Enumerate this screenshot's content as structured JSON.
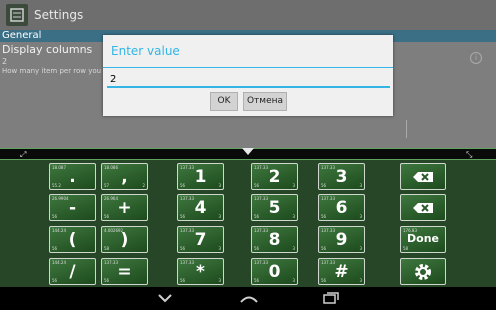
{
  "app": {
    "title": "Settings",
    "icon": "settings-app-icon"
  },
  "prefs": {
    "section": "General",
    "title": "Display columns",
    "value": "2",
    "summary": "How many item per row you w",
    "info_icon": "info-icon"
  },
  "dialog": {
    "title": "Enter value",
    "input_value": "2",
    "ok_label": "OK",
    "cancel_label": "Отмена"
  },
  "keyboard": {
    "colors": {
      "key_bg": "#2f632f",
      "board_bg": "#274527",
      "accent": "#33b5e5"
    },
    "strip": {
      "left_icon": "expand-icon",
      "center_icon": "collapse-arrow-icon",
      "right_icon": "resize-icon"
    },
    "keys": [
      {
        "id": "dot",
        "label": ".",
        "tl": "18.087",
        "tr": "",
        "bl": "55.2",
        "br": "",
        "row": 0,
        "col": 0
      },
      {
        "id": "comma",
        "label": ",",
        "tl": "18.086",
        "tr": "1",
        "bl": "57",
        "br": "2",
        "row": 0,
        "col": 1
      },
      {
        "id": "one",
        "label": "1",
        "tl": "137.33",
        "tr": "",
        "bl": "56",
        "br": "3",
        "row": 0,
        "col": 2
      },
      {
        "id": "two",
        "label": "2",
        "tl": "137.33",
        "tr": "",
        "bl": "56",
        "br": "3",
        "row": 0,
        "col": 3
      },
      {
        "id": "three",
        "label": "3",
        "tl": "137.33",
        "tr": "",
        "bl": "56",
        "br": "3",
        "row": 0,
        "col": 4
      },
      {
        "id": "minus",
        "label": "-",
        "tl": "26.9904",
        "tr": "",
        "bl": "56",
        "br": "",
        "row": 1,
        "col": 0
      },
      {
        "id": "plus",
        "label": "+",
        "tl": "26.964",
        "tr": "",
        "bl": "56",
        "br": "",
        "row": 1,
        "col": 1
      },
      {
        "id": "four",
        "label": "4",
        "tl": "137.33",
        "tr": "",
        "bl": "56",
        "br": "3",
        "row": 1,
        "col": 2
      },
      {
        "id": "five",
        "label": "5",
        "tl": "137.33",
        "tr": "",
        "bl": "56",
        "br": "3",
        "row": 1,
        "col": 3
      },
      {
        "id": "six",
        "label": "6",
        "tl": "137.33",
        "tr": "",
        "bl": "56",
        "br": "3",
        "row": 1,
        "col": 4
      },
      {
        "id": "lparen",
        "label": "(",
        "tl": "144.24",
        "tr": "",
        "bl": "56",
        "br": "",
        "row": 2,
        "col": 0
      },
      {
        "id": "rparen",
        "label": ")",
        "tl": "4.002692",
        "tr": "",
        "bl": "58",
        "br": "",
        "row": 2,
        "col": 1
      },
      {
        "id": "seven",
        "label": "7",
        "tl": "137.33",
        "tr": "",
        "bl": "56",
        "br": "3",
        "row": 2,
        "col": 2
      },
      {
        "id": "eight",
        "label": "8",
        "tl": "137.33",
        "tr": "",
        "bl": "56",
        "br": "3",
        "row": 2,
        "col": 3
      },
      {
        "id": "nine",
        "label": "9",
        "tl": "137.33",
        "tr": "",
        "bl": "56",
        "br": "3",
        "row": 2,
        "col": 4
      },
      {
        "id": "slash",
        "label": "/",
        "tl": "144.24",
        "tr": "",
        "bl": "56",
        "br": "",
        "row": 3,
        "col": 0
      },
      {
        "id": "equals",
        "label": "=",
        "tl": "137.33",
        "tr": "",
        "bl": "56",
        "br": "",
        "row": 3,
        "col": 1
      },
      {
        "id": "star",
        "label": "*",
        "tl": "137.33",
        "tr": "",
        "bl": "56",
        "br": "3",
        "row": 3,
        "col": 2
      },
      {
        "id": "zero",
        "label": "0",
        "tl": "137.33",
        "tr": "",
        "bl": "56",
        "br": "3",
        "row": 3,
        "col": 3
      },
      {
        "id": "hash",
        "label": "#",
        "tl": "137.33",
        "tr": "",
        "bl": "56",
        "br": "3",
        "row": 3,
        "col": 4
      }
    ],
    "func_keys": [
      {
        "id": "backspace",
        "label": "",
        "icon": "backspace-icon",
        "tl": "",
        "bl": ""
      },
      {
        "id": "clear",
        "label": "",
        "icon": "clear-icon",
        "tl": "",
        "bl": ""
      },
      {
        "id": "done",
        "label": "Done",
        "icon": "",
        "tl": "176.83",
        "bl": "58"
      },
      {
        "id": "settings",
        "label": "",
        "icon": "gear-icon",
        "tl": "",
        "bl": ""
      }
    ]
  },
  "navbar": {
    "back": "back-icon",
    "home": "home-icon",
    "recents": "recents-icon"
  }
}
